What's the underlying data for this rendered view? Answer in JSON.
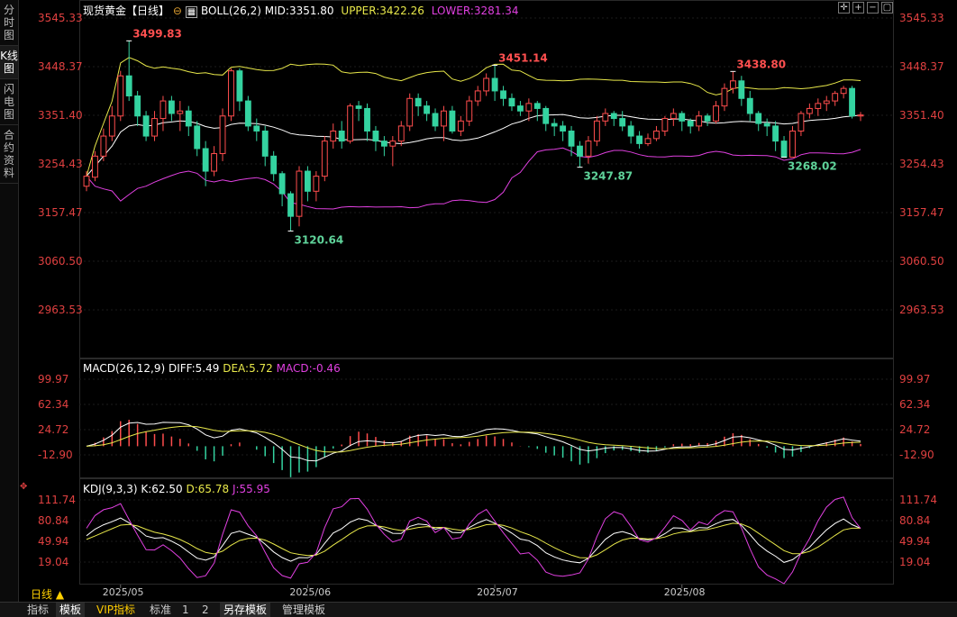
{
  "sidebar": {
    "tabs": [
      "分时图",
      "K线图",
      "闪电图",
      "合约资料"
    ],
    "active": 1
  },
  "header": {
    "title": "现货黄金【日线】",
    "boll": "BOLL(26,2)",
    "mid": "MID:3351.80",
    "upper": "UPPER:3422.26",
    "lower": "LOWER:3281.34"
  },
  "macd_header": {
    "name": "MACD(26,12,9)",
    "diff": "DIFF:5.49",
    "dea": "DEA:5.72",
    "macd": "MACD:-0.46"
  },
  "kdj_header": {
    "name": "KDJ(9,3,3)",
    "k": "K:62.50",
    "d": "D:65.78",
    "j": "J:55.95"
  },
  "price_axis": [
    "3545.33",
    "3448.37",
    "3351.40",
    "3254.43",
    "3157.47",
    "3060.50",
    "2963.53"
  ],
  "macd_axis": [
    "99.97",
    "62.34",
    "24.72",
    "-12.90"
  ],
  "kdj_axis": [
    "111.74",
    "80.84",
    "49.94",
    "19.04"
  ],
  "annotations": {
    "high1": "3499.83",
    "low1": "3120.64",
    "high2": "3451.14",
    "low2": "3247.87",
    "high3": "3438.80",
    "low3": "3268.02"
  },
  "x_axis": {
    "period_label": "日线",
    "months": [
      "2025/05",
      "2025/06",
      "2025/07",
      "2025/08"
    ]
  },
  "bottom_tabs": [
    "指标",
    "模板",
    "VIP指标",
    "标准",
    "1",
    "2",
    "另存模板",
    "管理模板"
  ],
  "colors": {
    "up": "#ff4d4d",
    "down": "#34d3a0",
    "mid": "#ffffff",
    "upper": "#e8e84a",
    "lower": "#e040e0"
  },
  "chart_data": {
    "type": "candlestick",
    "title": "现货黄金【日线】",
    "price_range": [
      2890,
      3560
    ],
    "candles": [
      [
        3210,
        3230,
        3200,
        3240
      ],
      [
        3228,
        3270,
        3220,
        3280
      ],
      [
        3270,
        3310,
        3260,
        3325
      ],
      [
        3310,
        3350,
        3300,
        3370
      ],
      [
        3350,
        3430,
        3340,
        3440
      ],
      [
        3430,
        3390,
        3380,
        3500
      ],
      [
        3390,
        3350,
        3330,
        3400
      ],
      [
        3350,
        3310,
        3300,
        3360
      ],
      [
        3310,
        3345,
        3300,
        3360
      ],
      [
        3345,
        3380,
        3320,
        3390
      ],
      [
        3380,
        3355,
        3340,
        3390
      ],
      [
        3355,
        3360,
        3320,
        3380
      ],
      [
        3360,
        3330,
        3310,
        3370
      ],
      [
        3330,
        3285,
        3270,
        3340
      ],
      [
        3285,
        3240,
        3210,
        3300
      ],
      [
        3240,
        3275,
        3230,
        3290
      ],
      [
        3275,
        3350,
        3260,
        3365
      ],
      [
        3350,
        3440,
        3340,
        3445
      ],
      [
        3440,
        3380,
        3360,
        3445
      ],
      [
        3380,
        3330,
        3320,
        3390
      ],
      [
        3330,
        3320,
        3300,
        3345
      ],
      [
        3320,
        3270,
        3250,
        3330
      ],
      [
        3270,
        3235,
        3220,
        3280
      ],
      [
        3235,
        3195,
        3170,
        3240
      ],
      [
        3195,
        3150,
        3120,
        3200
      ],
      [
        3150,
        3240,
        3130,
        3250
      ],
      [
        3240,
        3200,
        3180,
        3250
      ],
      [
        3200,
        3230,
        3180,
        3240
      ],
      [
        3230,
        3300,
        3220,
        3310
      ],
      [
        3300,
        3320,
        3285,
        3335
      ],
      [
        3320,
        3300,
        3285,
        3340
      ],
      [
        3300,
        3370,
        3295,
        3375
      ],
      [
        3370,
        3365,
        3340,
        3380
      ],
      [
        3365,
        3320,
        3300,
        3375
      ],
      [
        3320,
        3300,
        3280,
        3330
      ],
      [
        3300,
        3290,
        3270,
        3310
      ],
      [
        3290,
        3300,
        3250,
        3310
      ],
      [
        3300,
        3330,
        3290,
        3340
      ],
      [
        3330,
        3385,
        3320,
        3395
      ],
      [
        3385,
        3370,
        3350,
        3395
      ],
      [
        3370,
        3355,
        3340,
        3380
      ],
      [
        3355,
        3330,
        3320,
        3365
      ],
      [
        3330,
        3360,
        3300,
        3370
      ],
      [
        3360,
        3320,
        3315,
        3370
      ],
      [
        3320,
        3340,
        3310,
        3350
      ],
      [
        3340,
        3380,
        3330,
        3390
      ],
      [
        3380,
        3400,
        3370,
        3410
      ],
      [
        3400,
        3425,
        3390,
        3435
      ],
      [
        3425,
        3400,
        3380,
        3451
      ],
      [
        3400,
        3385,
        3370,
        3410
      ],
      [
        3385,
        3370,
        3360,
        3395
      ],
      [
        3370,
        3360,
        3350,
        3380
      ],
      [
        3360,
        3375,
        3340,
        3385
      ],
      [
        3375,
        3365,
        3340,
        3380
      ],
      [
        3365,
        3335,
        3320,
        3370
      ],
      [
        3335,
        3330,
        3310,
        3345
      ],
      [
        3330,
        3320,
        3300,
        3340
      ],
      [
        3320,
        3290,
        3270,
        3330
      ],
      [
        3290,
        3270,
        3248,
        3300
      ],
      [
        3270,
        3300,
        3255,
        3310
      ],
      [
        3300,
        3340,
        3290,
        3350
      ],
      [
        3340,
        3355,
        3330,
        3365
      ],
      [
        3355,
        3345,
        3330,
        3360
      ],
      [
        3345,
        3330,
        3320,
        3360
      ],
      [
        3330,
        3310,
        3295,
        3340
      ],
      [
        3310,
        3295,
        3285,
        3320
      ],
      [
        3295,
        3305,
        3290,
        3315
      ],
      [
        3305,
        3320,
        3300,
        3330
      ],
      [
        3320,
        3345,
        3310,
        3350
      ],
      [
        3345,
        3355,
        3330,
        3365
      ],
      [
        3355,
        3340,
        3320,
        3360
      ],
      [
        3340,
        3330,
        3315,
        3345
      ],
      [
        3330,
        3350,
        3320,
        3360
      ],
      [
        3350,
        3340,
        3330,
        3355
      ],
      [
        3340,
        3370,
        3335,
        3380
      ],
      [
        3370,
        3405,
        3360,
        3415
      ],
      [
        3405,
        3420,
        3395,
        3439
      ],
      [
        3420,
        3385,
        3370,
        3430
      ],
      [
        3385,
        3355,
        3340,
        3400
      ],
      [
        3355,
        3335,
        3320,
        3360
      ],
      [
        3335,
        3330,
        3310,
        3345
      ],
      [
        3330,
        3300,
        3280,
        3340
      ],
      [
        3300,
        3268,
        3268,
        3310
      ],
      [
        3268,
        3320,
        3270,
        3330
      ],
      [
        3320,
        3355,
        3310,
        3360
      ],
      [
        3355,
        3365,
        3345,
        3375
      ],
      [
        3365,
        3375,
        3350,
        3385
      ],
      [
        3375,
        3380,
        3360,
        3390
      ],
      [
        3380,
        3395,
        3370,
        3400
      ],
      [
        3395,
        3405,
        3385,
        3410
      ],
      [
        3405,
        3350,
        3345,
        3410
      ],
      [
        3350,
        3352,
        3340,
        3358
      ]
    ]
  }
}
